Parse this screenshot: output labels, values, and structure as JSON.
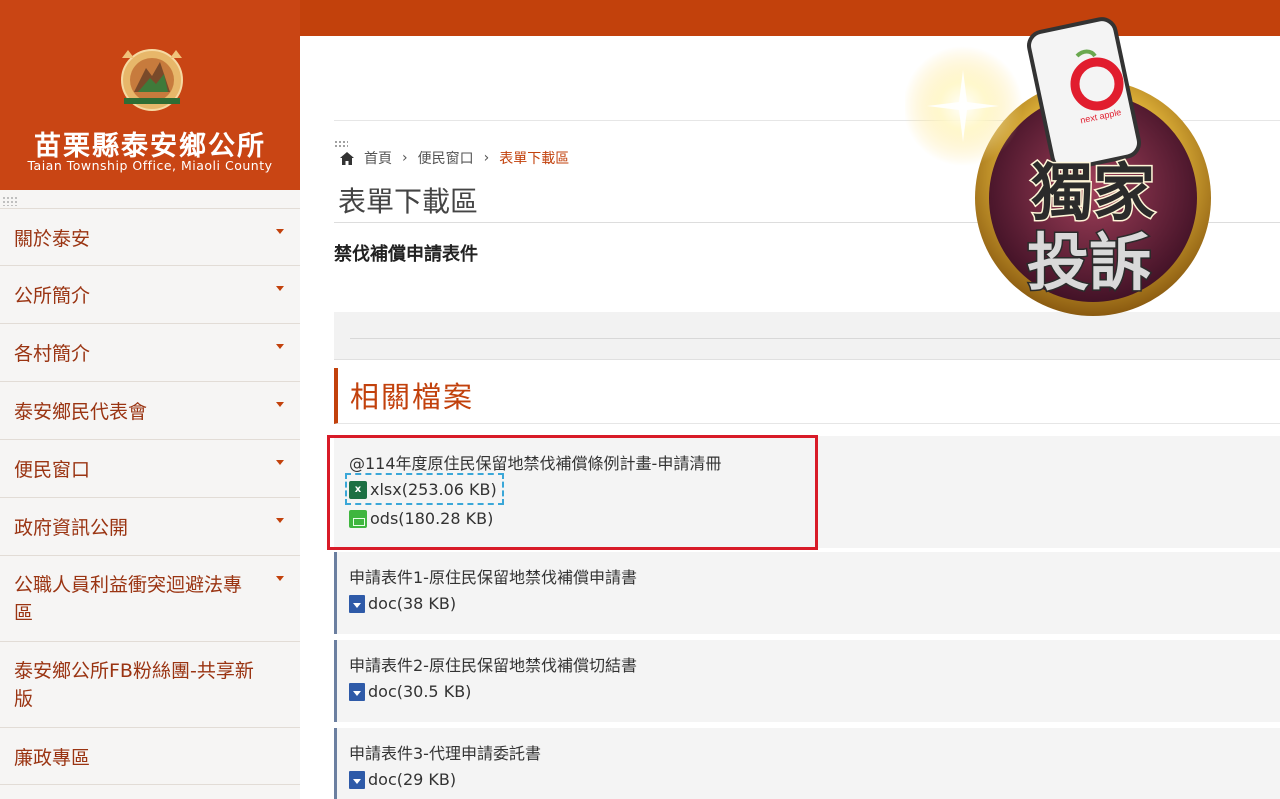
{
  "sidebar": {
    "site_name": "苗栗縣泰安鄉公所",
    "site_subtitle": "Taian Township Office, Miaoli County",
    "items": [
      {
        "label": "關於泰安"
      },
      {
        "label": "公所簡介"
      },
      {
        "label": "各村簡介"
      },
      {
        "label": "泰安鄉民代表會"
      },
      {
        "label": "便民窗口"
      },
      {
        "label": "政府資訊公開"
      },
      {
        "label": "公職人員利益衝突迴避法專區"
      },
      {
        "label": "泰安鄉公所FB粉絲團-共享新版"
      },
      {
        "label": "廉政專區"
      }
    ]
  },
  "breadcrumb": {
    "items": [
      "首頁",
      "便民窗口",
      "表單下載區"
    ],
    "separator": "›"
  },
  "page": {
    "title": "表單下載區",
    "subject": "禁伐補償申請表件",
    "section_title": "相關檔案"
  },
  "files": [
    {
      "title": "@114年度原住民保留地禁伐補償條例計畫-申請清冊",
      "links": [
        {
          "type": "xlsx",
          "icon": "excel-icon",
          "label": "xlsx(253.06 KB)"
        },
        {
          "type": "ods",
          "icon": "ods-icon",
          "label": "ods(180.28 KB)"
        }
      ]
    },
    {
      "title": "申請表件1-原住民保留地禁伐補償申請書",
      "links": [
        {
          "type": "doc",
          "icon": "doc-icon",
          "label": "doc(38 KB)"
        }
      ]
    },
    {
      "title": "申請表件2-原住民保留地禁伐補償切結書",
      "links": [
        {
          "type": "doc",
          "icon": "doc-icon",
          "label": "doc(30.5 KB)"
        }
      ]
    },
    {
      "title": "申請表件3-代理申請委託書",
      "links": [
        {
          "type": "doc",
          "icon": "doc-icon",
          "label": "doc(29 KB)"
        }
      ]
    }
  ],
  "overlay_badge": {
    "line1": "獨家",
    "line2": "投訴",
    "phone_brand": "next apple"
  },
  "colors": {
    "brand": "#c94514",
    "accent": "#c2410c",
    "highlight": "#d81b28",
    "dashed": "#3aa7d8"
  }
}
